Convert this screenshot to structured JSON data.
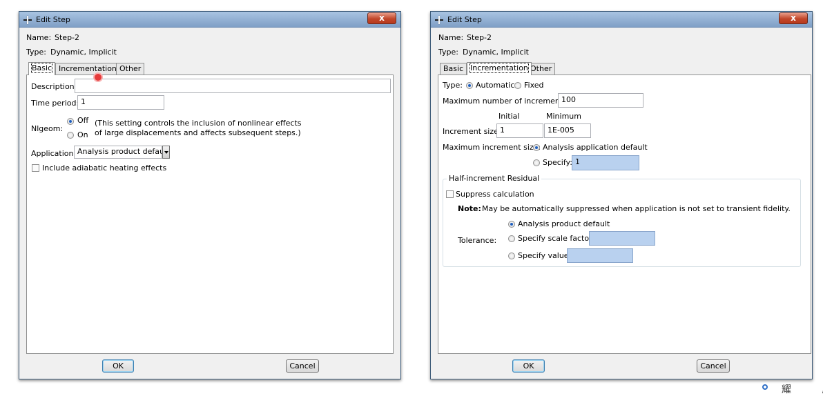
{
  "dialogs": [
    {
      "title": "Edit Step",
      "close_symbol": "x",
      "name_label": "Name:",
      "name_value": "Step-2",
      "type_label": "Type:",
      "type_value": "Dynamic, Implicit",
      "tabs": [
        "Basic",
        "Incrementation",
        "Other"
      ],
      "active_tab": "Basic",
      "basic": {
        "description_label": "Description:",
        "description_value": "",
        "time_period_label": "Time period:",
        "time_period_value": "1",
        "nlgeom_label": "Nlgeom:",
        "nlgeom_off": "Off",
        "nlgeom_on": "On",
        "nlgeom_selected": "Off",
        "nlgeom_note_line1": "(This setting controls the inclusion of nonlinear effects",
        "nlgeom_note_line2": "of large displacements and affects subsequent steps.)",
        "application_label": "Application:",
        "application_value": "Analysis product default",
        "adiabatic_label": "Include adiabatic heating effects",
        "adiabatic_checked": false
      },
      "ok_label": "OK",
      "cancel_label": "Cancel"
    },
    {
      "title": "Edit Step",
      "close_symbol": "x",
      "name_label": "Name:",
      "name_value": "Step-2",
      "type_label": "Type:",
      "type_value": "Dynamic, Implicit",
      "tabs": [
        "Basic",
        "Incrementation",
        "Other"
      ],
      "active_tab": "Incrementation",
      "incrementation": {
        "type_label": "Type:",
        "automatic_label": "Automatic",
        "fixed_label": "Fixed",
        "type_selected": "Automatic",
        "max_increments_label": "Maximum number of increments:",
        "max_increments_value": "100",
        "initial_header": "Initial",
        "minimum_header": "Minimum",
        "increment_size_label": "Increment size:",
        "initial_value": "1",
        "minimum_value": "1E-005",
        "max_increment_size_label": "Maximum increment size:",
        "analysis_application_default_label": "Analysis application default",
        "specify_label": "Specify:",
        "specify_value": "1",
        "half_increment_group_label": "Half-increment Residual",
        "suppress_label": "Suppress calculation",
        "suppress_checked": false,
        "note_label": "Note:",
        "note_text": "May be automatically suppressed when application is not set to transient fidelity.",
        "tolerance_label": "Tolerance:",
        "tol_option_default": "Analysis product default",
        "tol_option_scale": "Specify scale factor:",
        "tol_option_value": "Specify value:",
        "tolerance_selected": "Analysis product default"
      },
      "ok_label": "OK",
      "cancel_label": "Cancel"
    }
  ],
  "watermark": "耀 唐",
  "colors": {
    "title_bar": "#7f9fc6",
    "close_button": "#c1472a",
    "disabled_field": "#b9d1ef",
    "radio_selected": "#1f5fbf",
    "cursor_marker": "#e63a3a"
  }
}
